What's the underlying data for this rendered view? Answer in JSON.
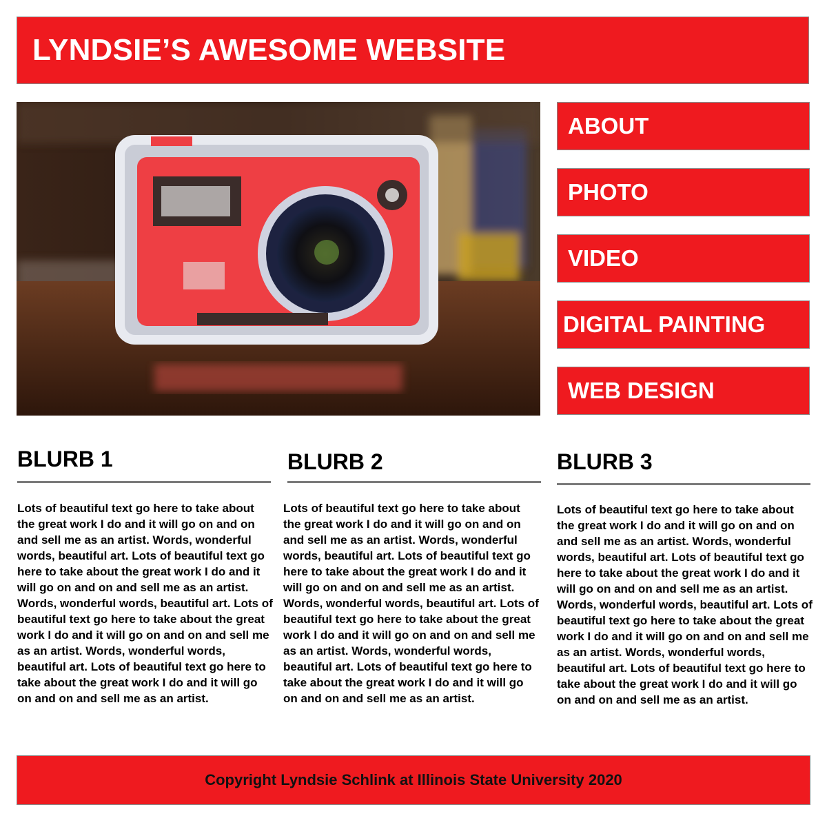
{
  "site": {
    "title": "LYNDSIE’S AWESOME WEBSITE"
  },
  "colors": {
    "brand_red": "#ef1a1f",
    "rule_gray": "#7a7a7a"
  },
  "hero_image": {
    "subject": "handmade red camera sculpture photo"
  },
  "nav": {
    "items": [
      {
        "label": "ABOUT"
      },
      {
        "label": "PHOTO"
      },
      {
        "label": "VIDEO"
      },
      {
        "label": "DIGITAL PAINTING"
      },
      {
        "label": "WEB DESIGN"
      }
    ]
  },
  "blurbs": [
    {
      "title": "BLURB 1",
      "body": "Lots of beautiful text go here to take about the great work I do and it will go on and on and sell me as an artist. Words, wonderful words, beautiful art. Lots of beautiful text go here to take about the great work I do and it will go on and on and sell me as an artist. Words, wonderful words, beautiful art. Lots of beautiful text go here to take about the great work I do and it will go on and on and sell me as an artist. Words, wonderful words, beautiful art. Lots of beautiful text go here to take about the great work I do and it will go on and on and sell me as an artist."
    },
    {
      "title": "BLURB 2",
      "body": "Lots of beautiful text go here to take about the great work I do and it will go on and on and sell me as an artist. Words, wonderful words, beautiful art. Lots of beautiful text go here to take about the great work I do and it will go on and on and sell me as an artist. Words, wonderful words, beautiful art. Lots of beautiful text go here to take about the great work I do and it will go on and on and sell me as an artist. Words, wonderful words, beautiful art. Lots of beautiful text go here to take about the great work I do and it will go on and on and sell me as an artist."
    },
    {
      "title": "BLURB 3",
      "body": "Lots of beautiful text go here to take about the great work I do and it will go on and on and sell me as an artist. Words, wonderful words, beautiful art. Lots of beautiful text go here to take about the great work I do and it will go on and on and sell me as an artist. Words, wonderful words, beautiful art. Lots of beautiful text go here to take about the great work I do and it will go on and on and sell me as an artist. Words, wonderful words, beautiful art. Lots of beautiful text go here to take about the great work I do and it will go on and on and sell me as an artist."
    }
  ],
  "footer": {
    "text": "Copyright Lyndsie Schlink at Illinois State University 2020"
  }
}
